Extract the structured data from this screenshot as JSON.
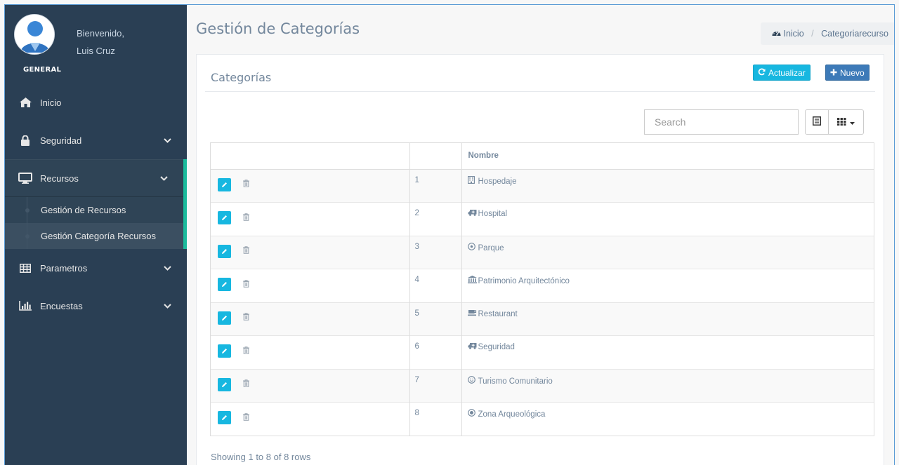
{
  "sidebar": {
    "welcome": "Bienvenido,",
    "user_name": "Luis Cruz",
    "section": "GENERAL",
    "items": [
      {
        "label": "Inicio",
        "icon": "home-icon"
      },
      {
        "label": "Seguridad",
        "icon": "lock-icon"
      },
      {
        "label": "Recursos",
        "icon": "desktop-icon"
      },
      {
        "label": "Parametros",
        "icon": "table-icon"
      },
      {
        "label": "Encuestas",
        "icon": "bar-chart-icon"
      }
    ],
    "sub_items": [
      {
        "label": "Gestión de Recursos"
      },
      {
        "label": "Gestión Categoría Recursos"
      }
    ]
  },
  "header": {
    "title": "Gestión de Categorías",
    "breadcrumb": {
      "home": "Inicio",
      "separator": "/",
      "current": "Categoriarecurso"
    }
  },
  "panel": {
    "title": "Categorías",
    "refresh_label": "Actualizar",
    "new_label": "Nuevo"
  },
  "search": {
    "placeholder": "Search"
  },
  "table": {
    "columns": [
      "",
      "",
      "Nombre"
    ],
    "rows": [
      {
        "num": "1",
        "icon": "building-icon",
        "name": "Hospedaje"
      },
      {
        "num": "2",
        "icon": "ambulance-icon",
        "name": "Hospital"
      },
      {
        "num": "3",
        "icon": "futbol-icon",
        "name": "Parque"
      },
      {
        "num": "4",
        "icon": "institution-icon",
        "name": "Patrimonio Arquitectónico"
      },
      {
        "num": "5",
        "icon": "coffee-icon",
        "name": "Restaurant"
      },
      {
        "num": "6",
        "icon": "ambulance-icon",
        "name": "Seguridad"
      },
      {
        "num": "7",
        "icon": "smile-icon",
        "name": "Turismo Comunitario"
      },
      {
        "num": "8",
        "icon": "dot-circle-icon",
        "name": "Zona Arqueológica"
      }
    ]
  },
  "footer": {
    "text": "Showing 1 to 8 of 8 rows"
  },
  "colors": {
    "sidebar_bg": "#2a3f54",
    "accent_green": "#1abb9c",
    "info_button": "#17b7e0",
    "primary_button": "#3d7ab8"
  }
}
